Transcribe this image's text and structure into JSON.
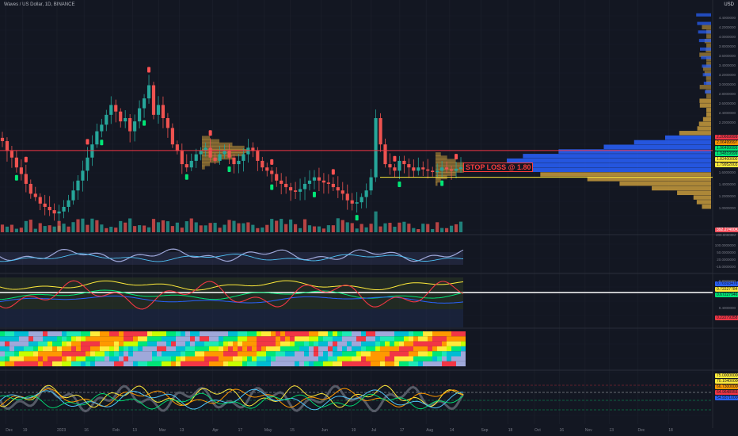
{
  "header": {
    "symbol_line": "Waves / US Dollar, 1D, BINANCE",
    "currency": "USD"
  },
  "annotation": {
    "stop_loss": "STOP LOSS @ 1.80"
  },
  "price_axis": [
    "4.4000000",
    "4.2000000",
    "4.0000000",
    "3.8000000",
    "3.6000000",
    "3.4000000",
    "3.2000000",
    "3.0000000",
    "2.8000000",
    "2.6000000",
    "2.4000000",
    "2.2000000",
    "1.6000000",
    "1.4000000",
    "1.2000000",
    "1.0000000"
  ],
  "price_tags": [
    {
      "text": "2.20669999",
      "color": "#f23645"
    },
    {
      "text": "2.06499997",
      "color": "#ff9800"
    },
    {
      "text": "1.96499999",
      "color": "#00e676"
    },
    {
      "text": "1.94819999",
      "color": "#00e676"
    },
    {
      "text": "1.82400000",
      "color": "#ffeb3b"
    },
    {
      "text": "1.79952003",
      "color": "#ffeb3b"
    }
  ],
  "volume_tag": {
    "text": "392.27400K",
    "color": "#f7525f"
  },
  "volume_axis_label": "400.00000M",
  "osc1_axis": [
    "100.0000000",
    "50.0000000",
    "20.0000000",
    "-15.0000000"
  ],
  "osc2_tags": [
    {
      "text": "0.76593476",
      "color": "#2962ff"
    },
    {
      "text": "0.72227784",
      "color": "#ffeb3b"
    },
    {
      "text": "0.67227946",
      "color": "#00e676"
    },
    {
      "text": "0.22279358",
      "color": "#f23645"
    }
  ],
  "osc2_axis": [
    "0.8000000",
    "0.4000000"
  ],
  "heat_axis": [
    "28.0000000",
    "24.0000000",
    "20.0000000",
    "16.0000000",
    "14.0000000",
    "12.0000000"
  ],
  "osc4_tags": [
    {
      "text": "75.00000000",
      "color": "#ffeb3b"
    },
    {
      "text": "70.10400000",
      "color": "#ffeb3b"
    },
    {
      "text": "66.73000000",
      "color": "#ff9800"
    },
    {
      "text": "64.96489551",
      "color": "#f23645"
    },
    {
      "text": "54.93710000",
      "color": "#2962ff"
    }
  ],
  "x_axis": [
    {
      "label": "Dec",
      "frac": 0.008
    },
    {
      "label": "19",
      "frac": 0.032
    },
    {
      "label": "2023",
      "frac": 0.08
    },
    {
      "label": "16",
      "frac": 0.118
    },
    {
      "label": "Feb",
      "frac": 0.158
    },
    {
      "label": "13",
      "frac": 0.186
    },
    {
      "label": "Mar",
      "frac": 0.223
    },
    {
      "label": "13",
      "frac": 0.252
    },
    {
      "label": "Apr",
      "frac": 0.298
    },
    {
      "label": "17",
      "frac": 0.334
    },
    {
      "label": "May",
      "frac": 0.371
    },
    {
      "label": "15",
      "frac": 0.407
    },
    {
      "label": "Jun",
      "frac": 0.451
    },
    {
      "label": "19",
      "frac": 0.493
    },
    {
      "label": "Jul",
      "frac": 0.521
    },
    {
      "label": "17",
      "frac": 0.561
    },
    {
      "label": "Aug",
      "frac": 0.598
    },
    {
      "label": "14",
      "frac": 0.631
    },
    {
      "label": "Sep",
      "frac": 0.675
    },
    {
      "label": "18",
      "frac": 0.713
    },
    {
      "label": "Oct",
      "frac": 0.75
    },
    {
      "label": "16",
      "frac": 0.785
    },
    {
      "label": "Nov",
      "frac": 0.821
    },
    {
      "label": "13",
      "frac": 0.855
    },
    {
      "label": "Dec",
      "frac": 0.895
    },
    {
      "label": "18",
      "frac": 0.938
    }
  ],
  "colors": {
    "bg": "#131722",
    "bull": "#26a69a",
    "bear": "#ef5350",
    "signal_up": "#00e676",
    "signal_down": "#ff5252",
    "profile_gold": "#c89b3c",
    "profile_blue": "#2962ff"
  },
  "chart_data": {
    "type": "candlestick",
    "title": "Waves / US Dollar, 1D, BINANCE",
    "ylim": [
      1.0,
      4.4
    ],
    "horizontal_lines": [
      {
        "value": 2.2067,
        "color": "#f23645"
      },
      {
        "value": 1.8,
        "color": "#ffeb3b"
      }
    ],
    "close_series": [
      2.35,
      2.2,
      2.1,
      1.95,
      1.85,
      1.7,
      1.55,
      1.5,
      1.4,
      1.35,
      1.3,
      1.25,
      1.28,
      1.35,
      1.45,
      1.6,
      1.75,
      1.9,
      2.1,
      2.3,
      2.5,
      2.6,
      2.75,
      2.9,
      2.8,
      2.65,
      2.7,
      2.5,
      2.65,
      2.85,
      3.0,
      3.2,
      2.75,
      2.9,
      2.7,
      2.55,
      2.3,
      2.2,
      2.0,
      1.95,
      2.05,
      2.15,
      2.2,
      2.25,
      2.1,
      2.05,
      2.15,
      2.2,
      2.1,
      2.0,
      2.05,
      2.15,
      2.25,
      2.2,
      2.05,
      1.95,
      1.9,
      1.85,
      1.75,
      1.7,
      1.65,
      1.6,
      1.58,
      1.62,
      1.7,
      1.75,
      1.8,
      1.75,
      1.72,
      1.7,
      1.65,
      1.6,
      1.55,
      1.45,
      1.4,
      1.42,
      1.5,
      1.6,
      1.8,
      2.7,
      2.3,
      2.0,
      1.95,
      1.9,
      2.05,
      2.0,
      1.95,
      1.9,
      1.95,
      1.92,
      1.9,
      1.88,
      1.9,
      1.95,
      1.92,
      1.9,
      1.93,
      1.95
    ]
  }
}
